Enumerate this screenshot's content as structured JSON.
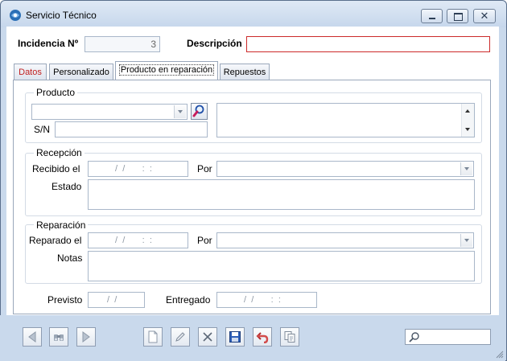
{
  "window": {
    "title": "Servicio Técnico"
  },
  "header": {
    "incidencia_label": "Incidencia Nº",
    "incidencia_value": "3",
    "descripcion_label": "Descripción",
    "descripcion_value": ""
  },
  "tabs": [
    {
      "label": "Datos",
      "active": false
    },
    {
      "label": "Personalizado",
      "active": false
    },
    {
      "label": "Producto en reparación",
      "active": true
    },
    {
      "label": "Repuestos",
      "active": false
    }
  ],
  "producto": {
    "group_title": "Producto",
    "combo_value": "",
    "sn_label": "S/N",
    "sn_value": "",
    "description_value": ""
  },
  "recepcion": {
    "group_title": "Recepción",
    "recibido_label": "Recibido el",
    "recibido_mask": " /  /       :  :",
    "por_label": "Por",
    "por_value": "",
    "estado_label": "Estado",
    "estado_value": ""
  },
  "reparacion": {
    "group_title": "Reparación",
    "reparado_label": "Reparado el",
    "reparado_mask": " /  /       :  :",
    "por_label": "Por",
    "por_value": "",
    "notas_label": "Notas",
    "notas_value": ""
  },
  "footer_fields": {
    "previsto_label": "Previsto",
    "previsto_mask": " /  /",
    "entregado_label": "Entregado",
    "entregado_mask": " /  /       :  :"
  },
  "toolbar": {
    "buttons": [
      "previous-icon",
      "binoculars-icon",
      "next-icon",
      "new-document-icon",
      "edit-icon",
      "delete-icon",
      "save-icon",
      "undo-icon",
      "copy-icon"
    ],
    "search_value": ""
  },
  "colors": {
    "accent_red": "#cc2a2a",
    "frame": "#c9d9ec",
    "save_blue": "#1f4fa8"
  }
}
